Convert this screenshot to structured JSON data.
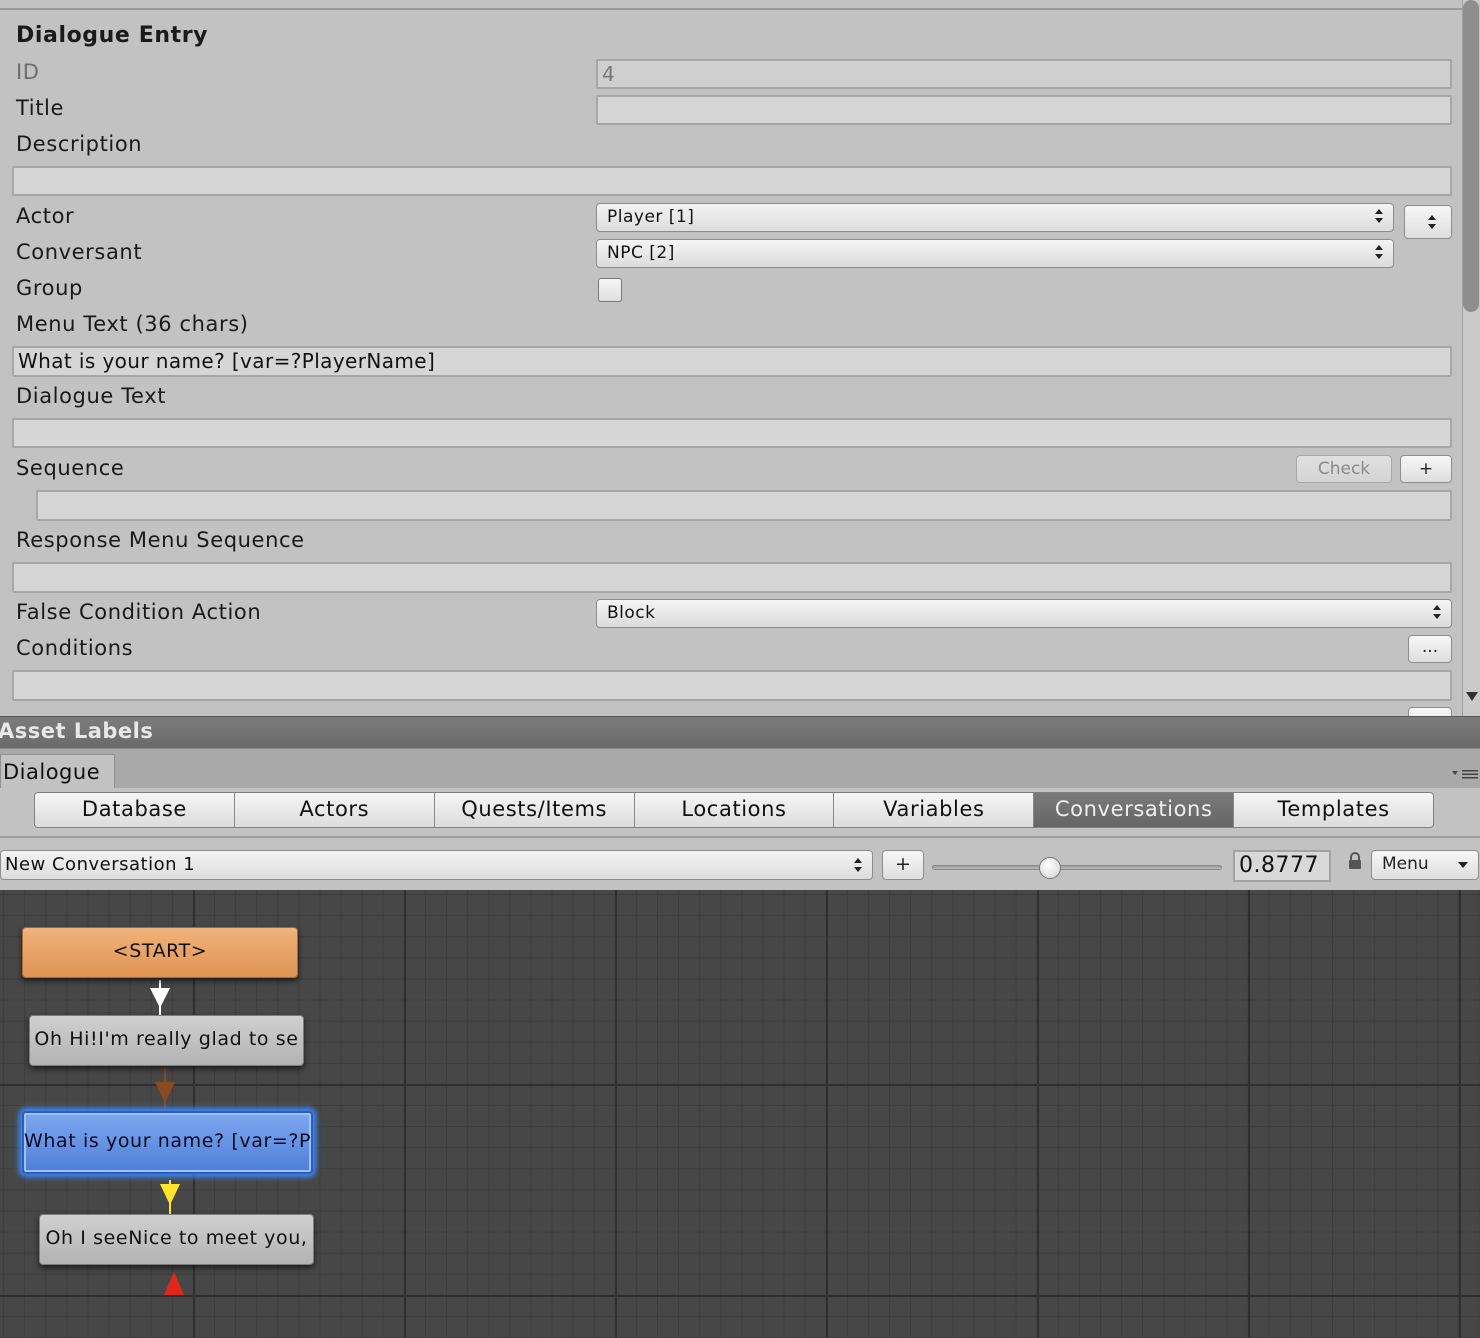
{
  "inspector": {
    "header": "Dialogue Entry",
    "id_label": "ID",
    "id_value": "4",
    "title_label": "Title",
    "title_value": "",
    "description_label": "Description",
    "description_value": "",
    "actor_label": "Actor",
    "actor_value": "Player [1]",
    "conversant_label": "Conversant",
    "conversant_value": "NPC [2]",
    "group_label": "Group",
    "group_checked": false,
    "menu_text_label": "Menu Text (36 chars)",
    "menu_text_value": "What is your name? [var=?PlayerName]",
    "dialogue_text_label": "Dialogue Text",
    "dialogue_text_value": "",
    "sequence_label": "Sequence",
    "check_button": "Check",
    "plus_button": "+",
    "sequence_value": "",
    "response_menu_sequence_label": "Response Menu Sequence",
    "response_menu_sequence_value": "",
    "false_condition_action_label": "False Condition Action",
    "false_condition_action_value": "Block",
    "conditions_label": "Conditions",
    "conditions_button": "...",
    "conditions_value": ""
  },
  "asset_labels": "Asset Labels",
  "dialogue_tab": "Dialogue",
  "main_tabs": [
    "Database",
    "Actors",
    "Quests/Items",
    "Locations",
    "Variables",
    "Conversations",
    "Templates"
  ],
  "active_tab": "Conversations",
  "toolbar": {
    "conversation": "New Conversation 1",
    "add_button": "+",
    "zoom_value": "0.8777",
    "zoom_fraction": 0.4,
    "menu_button": "Menu"
  },
  "nodes": [
    {
      "text": "<START>"
    },
    {
      "text": "Oh Hi!I'm really glad to se"
    },
    {
      "text": "What is your name? [var=?P"
    },
    {
      "text": "Oh I seeNice to meet you,"
    }
  ],
  "colors": {
    "start_node": "#e8a063",
    "selected_node": "#5b8ce0",
    "link_white": "#ffffff",
    "link_brown": "#8a4a22",
    "link_yellow": "#ffe42a",
    "link_red": "#e0281a"
  }
}
